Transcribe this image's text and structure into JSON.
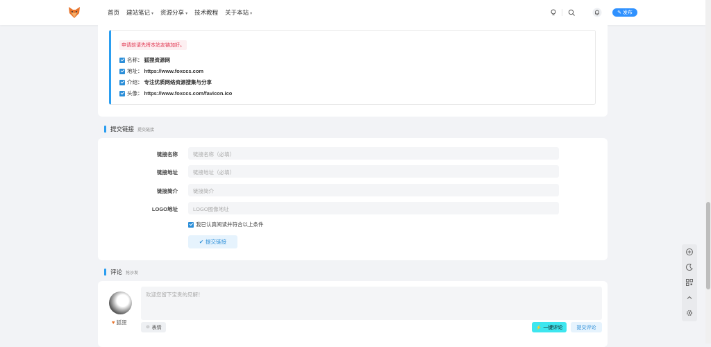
{
  "nav": {
    "items": [
      {
        "label": "首页",
        "has_dropdown": false
      },
      {
        "label": "建站笔记",
        "has_dropdown": true
      },
      {
        "label": "资源分享",
        "has_dropdown": true
      },
      {
        "label": "技术教程",
        "has_dropdown": false
      },
      {
        "label": "关于本站",
        "has_dropdown": true
      }
    ],
    "icons": [
      "bulb-icon",
      "search-icon",
      "bell-icon"
    ],
    "publish_label": "发布"
  },
  "notice": {
    "warning": "申请前请先将本站友链加好。",
    "rows": [
      {
        "key": "名称：",
        "value": "狐狸资源网"
      },
      {
        "key": "地址：",
        "value": "https://www.foxccs.com"
      },
      {
        "key": "介绍：",
        "value": "专注优质网络资源搜集与分享"
      },
      {
        "key": "头像：",
        "value": "https://www.foxccs.com/favicon.ico"
      }
    ]
  },
  "submit_section": {
    "title": "提交链接",
    "subtitle": "提交链接"
  },
  "form": {
    "fields": [
      {
        "label": "链接名称",
        "placeholder": "链接名称（必填）"
      },
      {
        "label": "链接地址",
        "placeholder": "链接地址（必填）"
      },
      {
        "label": "链接简介",
        "placeholder": "链接简介"
      },
      {
        "label": "LOGO地址",
        "placeholder": "LOGO图像地址"
      }
    ],
    "agree_text": "我已认真阅读并符合以上条件",
    "submit_label": "提交链接"
  },
  "comment_section": {
    "title": "评论",
    "subtitle": "抢沙发"
  },
  "comment": {
    "username": "狐狸",
    "placeholder": "欢迎您留下宝贵的见解！",
    "emoji_label": "表情",
    "onekey_label": "一键评论",
    "submit_label": "提交评论"
  },
  "colors": {
    "accent": "#2b9ef0",
    "publish": "#2f91ff",
    "warning_text": "#e0334d",
    "onekey_bg": "#3ee6ef"
  },
  "floatbar_icons": [
    "add-circle-icon",
    "moon-icon",
    "qrcode-icon",
    "chevron-up-icon",
    "gear-icon"
  ]
}
